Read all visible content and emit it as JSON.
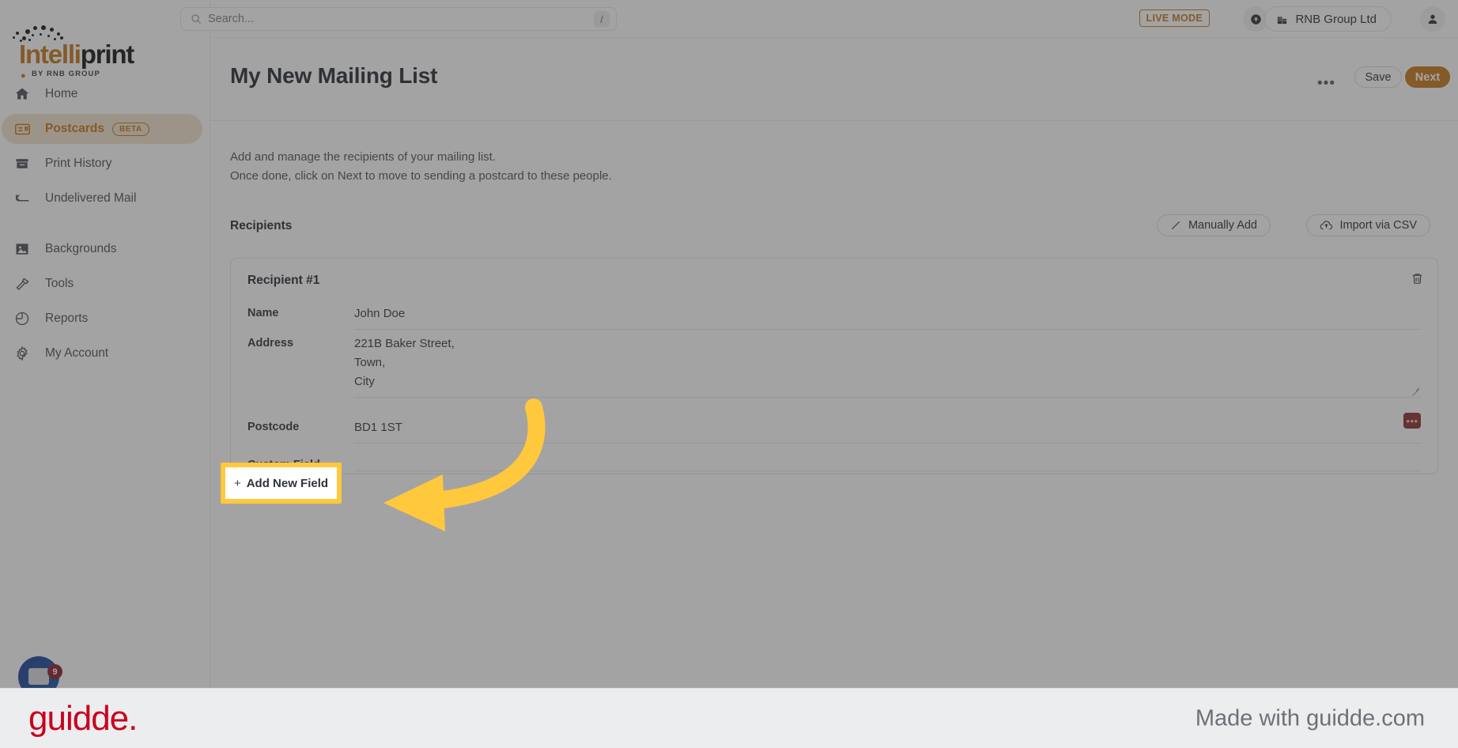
{
  "brand": {
    "logo_primary": "Intelli",
    "logo_secondary": "print",
    "logo_tagline": "BY RNB GROUP",
    "accent_color": "#c4761a"
  },
  "topbar": {
    "search_placeholder": "Search...",
    "search_value": "",
    "search_shortcut": "/",
    "live_mode_label": "LIVE MODE",
    "org_name": "RNB Group Ltd"
  },
  "sidebar": {
    "items": [
      {
        "label": "Home",
        "icon": "home-icon",
        "active": false
      },
      {
        "label": "Postcards",
        "icon": "postcard-icon",
        "active": true,
        "badge": "BETA"
      },
      {
        "label": "Print History",
        "icon": "archive-icon",
        "active": false
      },
      {
        "label": "Undelivered Mail",
        "icon": "return-arrow-icon",
        "active": false
      },
      {
        "label": "Backgrounds",
        "icon": "image-icon",
        "active": false
      },
      {
        "label": "Tools",
        "icon": "hammer-icon",
        "active": false
      },
      {
        "label": "Reports",
        "icon": "pie-chart-icon",
        "active": false
      },
      {
        "label": "My Account",
        "icon": "gear-icon",
        "active": false
      }
    ]
  },
  "header": {
    "title": "My New Mailing List",
    "more_label": "•••",
    "save_label": "Save",
    "next_label": "Next"
  },
  "main": {
    "description_line1": "Add and manage the recipients of your mailing list.",
    "description_line2": "Once done, click on Next to move to sending a postcard to these people.",
    "section_title": "Recipients",
    "manually_add_label": "Manually Add",
    "import_csv_label": "Import via CSV"
  },
  "recipient": {
    "title": "Recipient #1",
    "fields": [
      {
        "label": "Name",
        "value": "John Doe"
      },
      {
        "label": "Address",
        "value": "221B Baker Street,\nTown,\nCity"
      },
      {
        "label": "Postcode",
        "value": "BD1 1ST",
        "badge": "•••"
      },
      {
        "label": "Custom Field",
        "value": ""
      }
    ]
  },
  "annotation": {
    "add_new_field_label": "Add New Field",
    "add_new_field_plus": "+",
    "highlight_color": "#ffc83d"
  },
  "chat": {
    "unread_count": "9"
  },
  "footer": {
    "logo": "guidde.",
    "made_with": "Made with guidde.com"
  }
}
